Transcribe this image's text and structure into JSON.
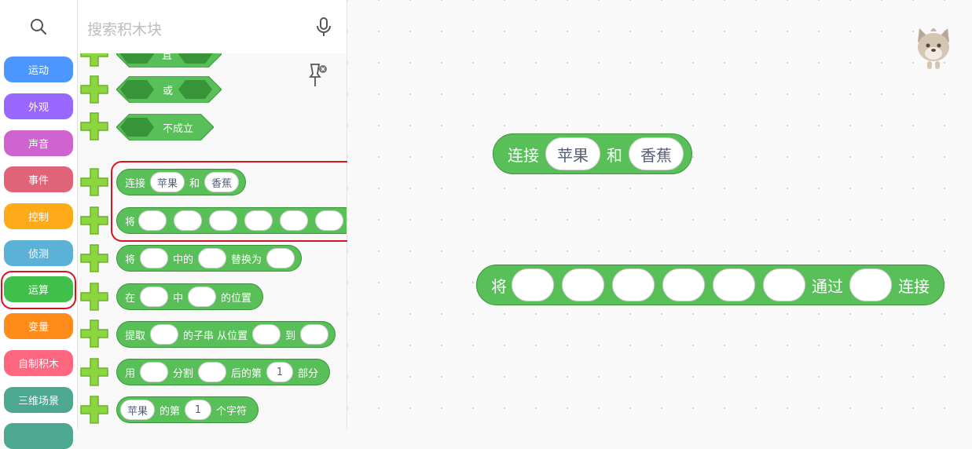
{
  "search": {
    "placeholder": "搜索积木块"
  },
  "categories": [
    {
      "label": "运动",
      "color": "#4c97ff"
    },
    {
      "label": "外观",
      "color": "#9966ff"
    },
    {
      "label": "声音",
      "color": "#cf63cf"
    },
    {
      "label": "事件",
      "color": "#e06477"
    },
    {
      "label": "控制",
      "color": "#ffab19"
    },
    {
      "label": "侦测",
      "color": "#5cb1d6"
    },
    {
      "label": "运算",
      "color": "#40bf4a",
      "selected": true
    },
    {
      "label": "变量",
      "color": "#ff8c1a"
    },
    {
      "label": "自制积木",
      "color": "#ff6680"
    },
    {
      "label": "三维场景",
      "color": "#4ca890"
    }
  ],
  "palette": {
    "blocks": {
      "and_text": "且",
      "or_text": "或",
      "not_text": "不成立",
      "join": {
        "label": "连接",
        "a": "苹果",
        "mid": "和",
        "b": "香蕉"
      },
      "join_via": {
        "label": "将",
        "via": "通过",
        "end": "连接"
      },
      "replace": {
        "label": "将",
        "mid1": "中的",
        "mid2": "替换为"
      },
      "position": {
        "label": "在",
        "mid": "中",
        "end": "的位置"
      },
      "substring": {
        "label": "提取",
        "mid1": "的子串 从位置",
        "mid2": "到"
      },
      "split": {
        "label": "用",
        "mid1": "分割",
        "mid2": "后的第",
        "num": "1",
        "end": "部分"
      },
      "char": {
        "a": "苹果",
        "mid": "的第",
        "num": "1",
        "end": "个字符"
      }
    }
  },
  "canvas": {
    "join": {
      "label": "连接",
      "a": "苹果",
      "mid": "和",
      "b": "香蕉"
    },
    "join_via": {
      "label": "将",
      "via": "通过",
      "end": "连接"
    }
  },
  "colors": {
    "operator_green": "#59c059",
    "highlight_red": "#d8141e"
  }
}
